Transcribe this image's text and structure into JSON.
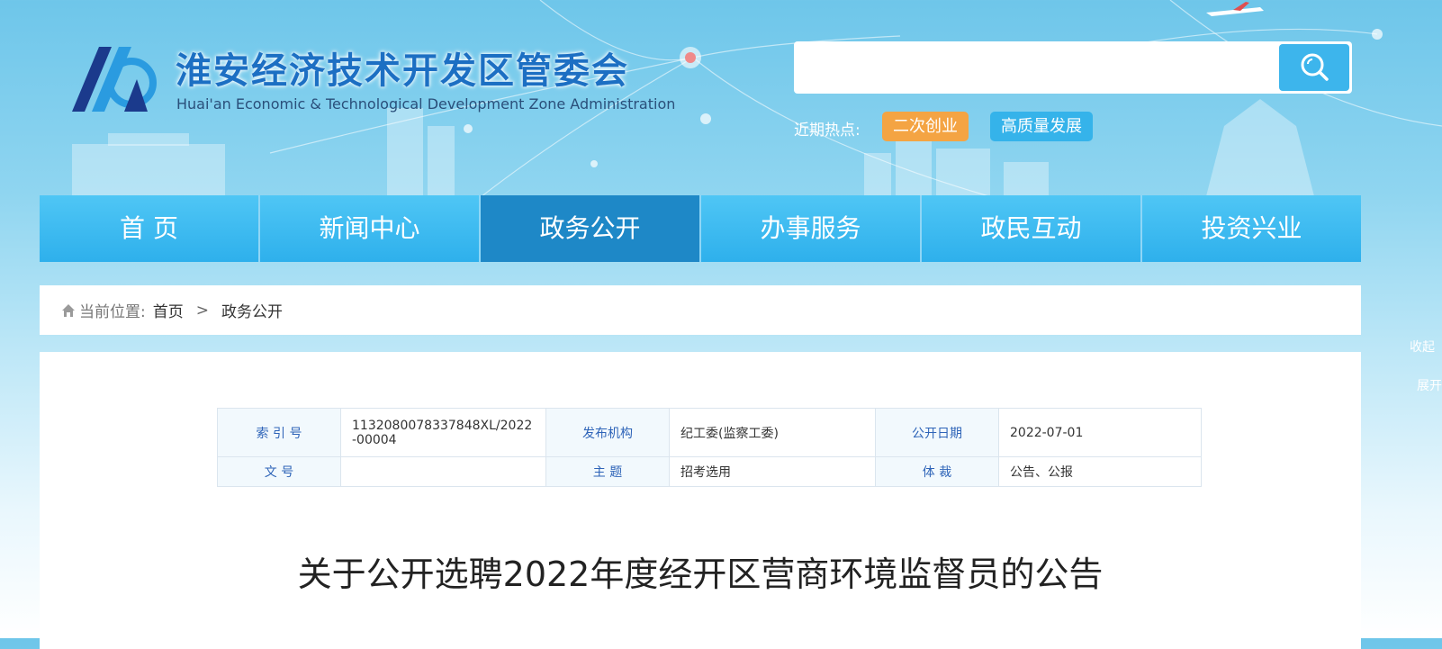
{
  "header": {
    "site_title": "淮安经济技术开发区管委会",
    "site_subtitle": "Huai'an Economic & Technological Development Zone Administration",
    "logo_icon": "haa-logo-icon"
  },
  "search": {
    "placeholder": "",
    "value": "",
    "button_icon": "search-icon"
  },
  "hot": {
    "label": "近期热点:",
    "tags": [
      "二次创业",
      "高质量发展"
    ]
  },
  "nav": {
    "items": [
      {
        "label": "首 页"
      },
      {
        "label": "新闻中心"
      },
      {
        "label": "政务公开"
      },
      {
        "label": "办事服务"
      },
      {
        "label": "政民互动"
      },
      {
        "label": "投资兴业"
      }
    ],
    "active_index": 2
  },
  "breadcrumb": {
    "label": "当前位置:",
    "home": "首页",
    "separator": ">",
    "current": "政务公开"
  },
  "meta": {
    "index_key": "索 引 号",
    "index_val": "1132080078337848XL/2022-00004",
    "org_key": "发布机构",
    "org_val": "纪工委(监察工委)",
    "date_key": "公开日期",
    "date_val": "2022-07-01",
    "doc_key": "文 号",
    "doc_val": "",
    "topic_key": "主 题",
    "topic_val": "招考选用",
    "genre_key": "体 裁",
    "genre_val": "公告、公报"
  },
  "article": {
    "title": "关于公开选聘2022年度经开区营商环境监督员的公告"
  },
  "side": {
    "collapse": "收起",
    "expand": "展开"
  },
  "colors": {
    "nav_bg": "#2eb0ec",
    "nav_active": "#1e88c7",
    "hot_orange": "#f4a443",
    "hot_blue": "#35b3ea",
    "title_blue": "#1c6fc3"
  }
}
